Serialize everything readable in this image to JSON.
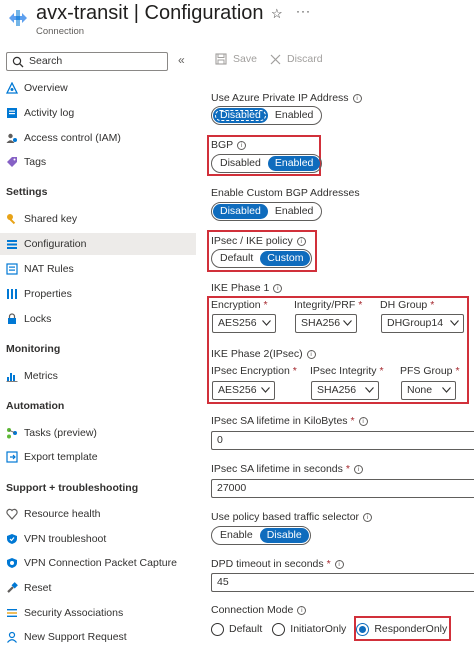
{
  "header": {
    "title": "avx-transit | Configuration",
    "subtitle": "Connection",
    "favorite_icon": "star-icon",
    "more_icon": "ellipsis-icon"
  },
  "sidebar": {
    "search_placeholder": "Search",
    "collapse_glyph": "«",
    "items": [
      {
        "label": "Overview",
        "icon": "overview-icon"
      },
      {
        "label": "Activity log",
        "icon": "activity-log-icon"
      },
      {
        "label": "Access control (IAM)",
        "icon": "iam-icon"
      },
      {
        "label": "Tags",
        "icon": "tag-icon"
      }
    ],
    "sections": [
      {
        "title": "Settings",
        "items": [
          {
            "label": "Shared key",
            "icon": "key-icon"
          },
          {
            "label": "Configuration",
            "icon": "configuration-icon",
            "active": true
          },
          {
            "label": "NAT Rules",
            "icon": "nat-rules-icon"
          },
          {
            "label": "Properties",
            "icon": "properties-icon"
          },
          {
            "label": "Locks",
            "icon": "lock-icon"
          }
        ]
      },
      {
        "title": "Monitoring",
        "items": [
          {
            "label": "Metrics",
            "icon": "metrics-icon"
          }
        ]
      },
      {
        "title": "Automation",
        "items": [
          {
            "label": "Tasks (preview)",
            "icon": "tasks-icon"
          },
          {
            "label": "Export template",
            "icon": "export-template-icon"
          }
        ]
      },
      {
        "title": "Support + troubleshooting",
        "items": [
          {
            "label": "Resource health",
            "icon": "heart-icon"
          },
          {
            "label": "VPN troubleshoot",
            "icon": "vpn-troubleshoot-icon"
          },
          {
            "label": "VPN Connection Packet Capture",
            "icon": "packet-capture-icon"
          },
          {
            "label": "Reset",
            "icon": "reset-icon"
          },
          {
            "label": "Security Associations",
            "icon": "security-associations-icon"
          },
          {
            "label": "New Support Request",
            "icon": "support-request-icon"
          }
        ]
      }
    ]
  },
  "toolbar": {
    "save_label": "Save",
    "discard_label": "Discard"
  },
  "form": {
    "private_ip": {
      "label": "Use Azure Private IP Address",
      "options": [
        "Disabled",
        "Enabled"
      ],
      "selected": "Disabled"
    },
    "bgp": {
      "label": "BGP",
      "options": [
        "Disabled",
        "Enabled"
      ],
      "selected": "Enabled"
    },
    "custom_bgp": {
      "label": "Enable Custom BGP Addresses",
      "options": [
        "Disabled",
        "Enabled"
      ],
      "selected": "Disabled"
    },
    "ipsec_policy": {
      "label": "IPsec / IKE policy",
      "options": [
        "Default",
        "Custom"
      ],
      "selected": "Custom"
    },
    "ike_phase1": {
      "title": "IKE Phase 1",
      "encryption": {
        "label": "Encryption",
        "value": "AES256"
      },
      "integrity": {
        "label": "Integrity/PRF",
        "value": "SHA256"
      },
      "dh_group": {
        "label": "DH Group",
        "value": "DHGroup14"
      }
    },
    "ike_phase2": {
      "title": "IKE Phase 2(IPsec)",
      "encryption": {
        "label": "IPsec Encryption",
        "value": "AES256"
      },
      "integrity": {
        "label": "IPsec Integrity",
        "value": "SHA256"
      },
      "pfs_group": {
        "label": "PFS Group",
        "value": "None"
      }
    },
    "sa_kilobytes": {
      "label": "IPsec SA lifetime in KiloBytes",
      "value": "0"
    },
    "sa_seconds": {
      "label": "IPsec SA lifetime in seconds",
      "value": "27000"
    },
    "policy_selector": {
      "label": "Use policy based traffic selector",
      "options": [
        "Enable",
        "Disable"
      ],
      "selected": "Disable"
    },
    "dpd_timeout": {
      "label": "DPD timeout in seconds",
      "value": "45"
    },
    "connection_mode": {
      "label": "Connection Mode",
      "options": [
        "Default",
        "InitiatorOnly",
        "ResponderOnly"
      ],
      "selected": "ResponderOnly"
    }
  },
  "colors": {
    "accent": "#0f6cbd",
    "highlight_box": "#d1303a"
  }
}
